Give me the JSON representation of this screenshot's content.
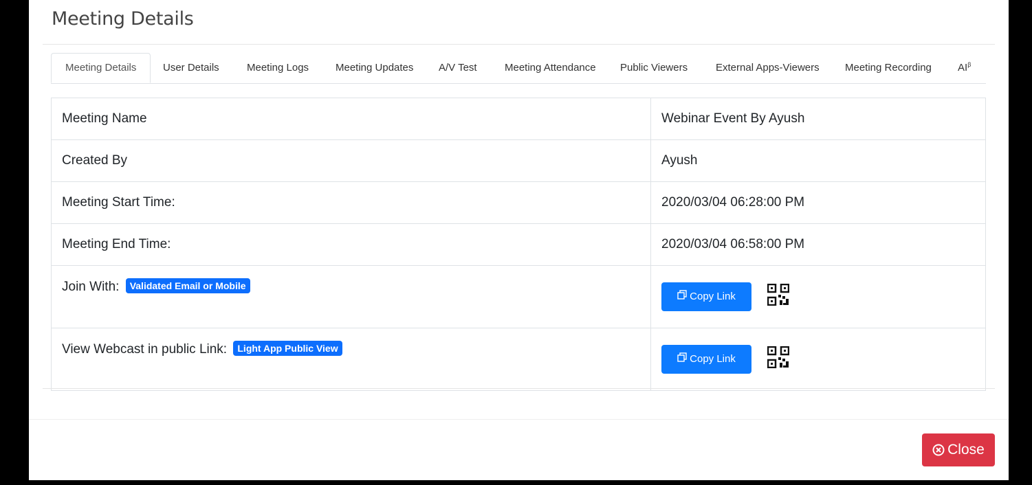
{
  "modal": {
    "title": "Meeting Details"
  },
  "tabs": [
    {
      "label": "Meeting Details",
      "active": true
    },
    {
      "label": "User Details"
    },
    {
      "label": "Meeting Logs"
    },
    {
      "label": "Meeting Updates"
    },
    {
      "label": "A/V Test"
    },
    {
      "label": "Meeting Attendance"
    },
    {
      "label": "Public Viewers"
    },
    {
      "label": "External Apps-Viewers"
    },
    {
      "label": "Meeting Recording"
    },
    {
      "label": "AI"
    }
  ],
  "tab_beta_mark": "β",
  "details": {
    "meeting_name_label": "Meeting Name",
    "meeting_name_value": "Webinar Event By Ayush",
    "created_by_label": "Created By",
    "created_by_value": "Ayush",
    "start_time_label": "Meeting Start Time:",
    "start_time_value": "2020/03/04 06:28:00 PM",
    "end_time_label": "Meeting End Time:",
    "end_time_value": "2020/03/04 06:58:00 PM",
    "join_with_label": "Join With:",
    "join_with_badge": "Validated Email or Mobile",
    "webcast_label": "View Webcast in public Link:",
    "webcast_badge": "Light App Public View",
    "copy_link_label": "Copy Link"
  },
  "icons": {
    "copy": "copy-icon",
    "qr": "qr-code-icon",
    "close": "close-circle-icon"
  },
  "footer": {
    "close_label": "Close"
  },
  "colors": {
    "primary": "#0d7bff",
    "danger": "#dc3545",
    "backdrop": "#000000"
  }
}
